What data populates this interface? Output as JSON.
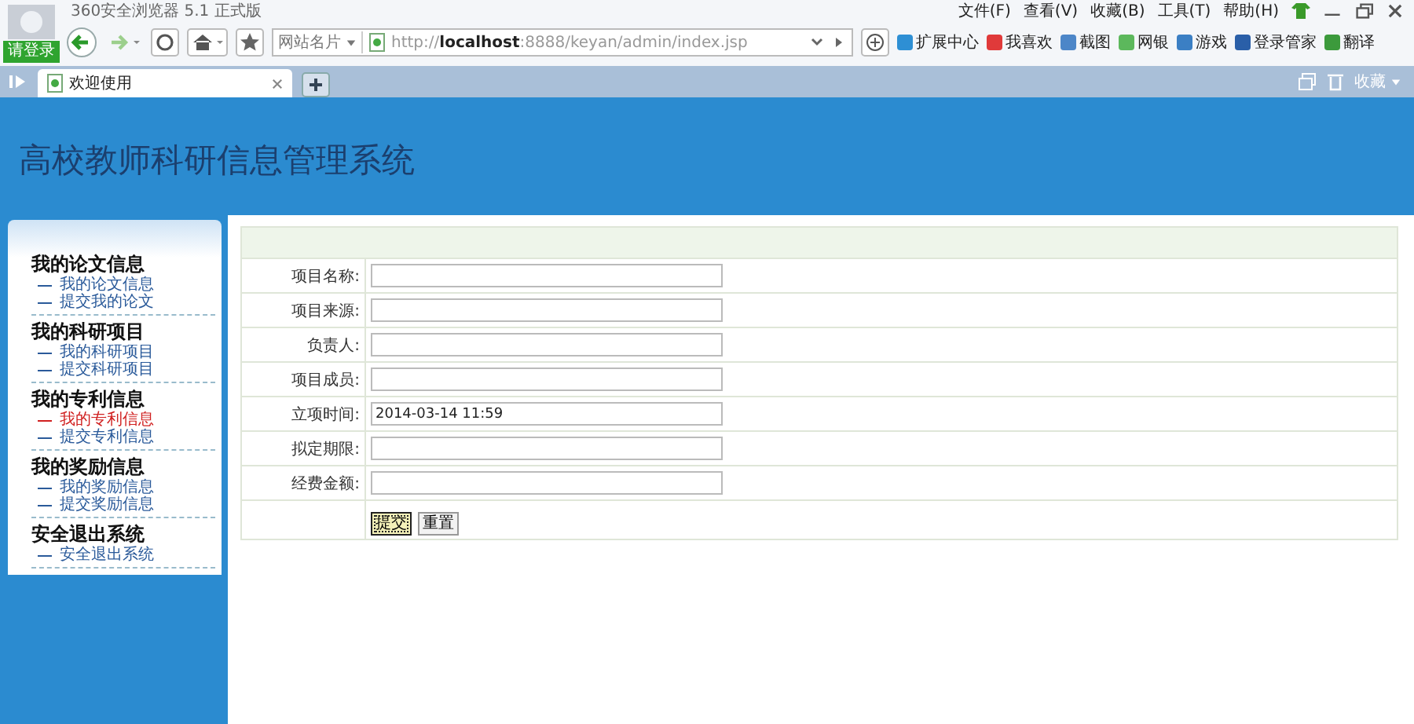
{
  "browser": {
    "title": "360安全浏览器 5.1 正式版",
    "login": "请登录",
    "site_cards": "网站名片",
    "address": "http://**localhost**:8888/keyan/admin/index.jsp",
    "menu": [
      "文件(F)",
      "查看(V)",
      "收藏(B)",
      "工具(T)",
      "帮助(H)"
    ],
    "toolbar": [
      "扩展中心",
      "我喜欢",
      "截图",
      "网银",
      "游戏",
      "登录管家",
      "翻译"
    ],
    "tabs": [
      {
        "label": "欢迎使用",
        "selected": true
      }
    ],
    "favorites": "收藏"
  },
  "header": {
    "title": "高校教师科研信息管理系统"
  },
  "sidebar": {
    "groups": [
      {
        "title": "我的论文信息",
        "items": [
          {
            "label": "我的论文信息",
            "selected": false
          },
          {
            "label": "提交我的论文",
            "selected": false
          }
        ]
      },
      {
        "title": "我的科研项目",
        "items": [
          {
            "label": "我的科研项目",
            "selected": false
          },
          {
            "label": "提交科研项目",
            "selected": false
          }
        ]
      },
      {
        "title": "我的专利信息",
        "items": [
          {
            "label": "我的专利信息",
            "selected": true
          },
          {
            "label": "提交专利信息",
            "selected": false
          }
        ]
      },
      {
        "title": "我的奖励信息",
        "items": [
          {
            "label": "我的奖励信息",
            "selected": false
          },
          {
            "label": "提交奖励信息",
            "selected": false
          }
        ]
      },
      {
        "title": "安全退出系统",
        "items": [
          {
            "label": "安全退出系统",
            "selected": false
          }
        ]
      }
    ]
  },
  "form": {
    "fields": [
      {
        "label": "项目名称:"
      },
      {
        "label": "项目来源:"
      },
      {
        "label": "负责人:"
      },
      {
        "label": "项目成员:"
      },
      {
        "label": "立项时间:",
        "value": "2014-03-14 11:59"
      },
      {
        "label": "拟定期限:"
      },
      {
        "label": "经费金额:"
      }
    ],
    "buttons": [
      {
        "label": "提交",
        "focused": true
      },
      {
        "label": "重置",
        "focused": false
      }
    ]
  }
}
